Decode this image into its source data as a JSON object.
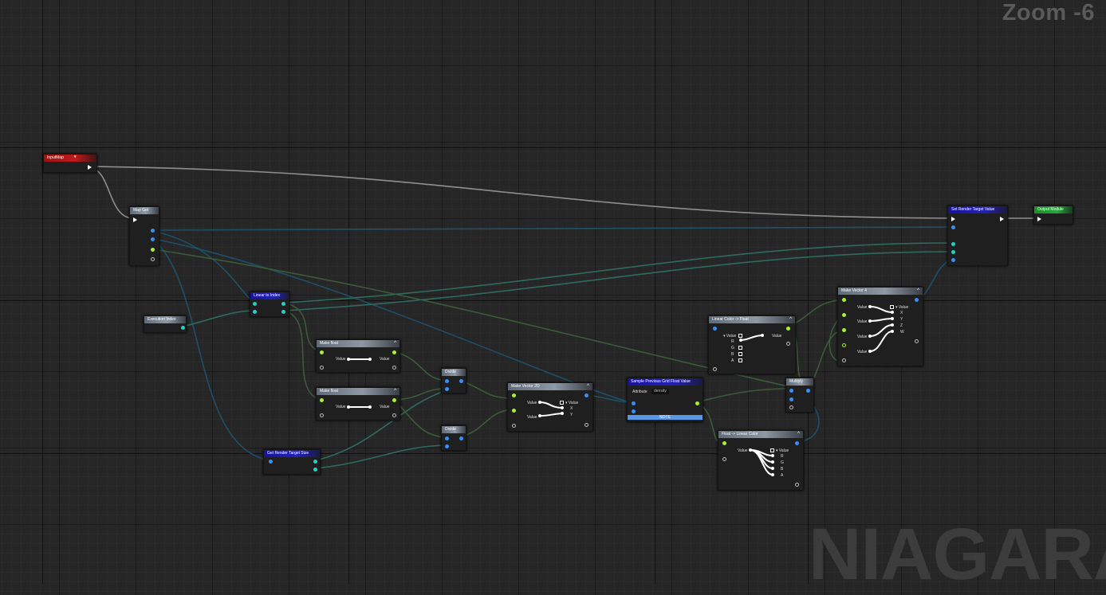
{
  "overlay": {
    "zoom": "Zoom -6",
    "watermark": "NIAGARA"
  },
  "colors": {
    "background": "#262626",
    "wire_exec": "#8f8f8f",
    "wire_blue": "#1f4f66",
    "wire_green": "#3c5a3a",
    "param_red": "#b81515",
    "output_green": "#23a936"
  },
  "nodes": {
    "input_map": {
      "title": "InputMap"
    },
    "map_get": {
      "title": "Map Get"
    },
    "execution_index": {
      "title": "Execution Index"
    },
    "linear_to_index": {
      "title": "Linear to Index"
    },
    "make_float_1": {
      "title": "Make float",
      "in_label": "Value",
      "out_label": "Value"
    },
    "make_float_2": {
      "title": "Make float",
      "in_label": "Value",
      "out_label": "Value"
    },
    "divide_1": {
      "title": "Divide"
    },
    "divide_2": {
      "title": "Divide"
    },
    "get_render_target_size": {
      "title": "Get Render Target Size"
    },
    "make_vector_2d": {
      "title": "Make Vector 2D",
      "in_label_1": "Value",
      "in_label_2": "Value",
      "out_label": "Value",
      "x": "X",
      "y": "Y"
    },
    "sample_grid": {
      "title": "Sample Previous Grid Float Value",
      "attribute_label": "Attribute",
      "attribute_value": "density",
      "note": "NOTE"
    },
    "linear_color_to_float": {
      "title": "Linear Color -> Float",
      "in_label": "Value",
      "r": "R",
      "g": "G",
      "b": "B",
      "a": "A",
      "out_label": "Value"
    },
    "multiply": {
      "title": "Multiply"
    },
    "float_to_linear_color": {
      "title": "Float -> Linear Color",
      "in_label": "Value",
      "out_label": "Value",
      "r": "R",
      "g": "G",
      "b": "B",
      "a": "A"
    },
    "make_vector_4": {
      "title": "Make Vector 4",
      "in_labels": [
        "Value",
        "Value",
        "Value",
        "Value"
      ],
      "out_label": "Value",
      "x": "X",
      "y": "Y",
      "z": "Z",
      "w": "W"
    },
    "set_render_target_value": {
      "title": "Set Render Target Value"
    },
    "output_module": {
      "title": "Output Module"
    }
  }
}
